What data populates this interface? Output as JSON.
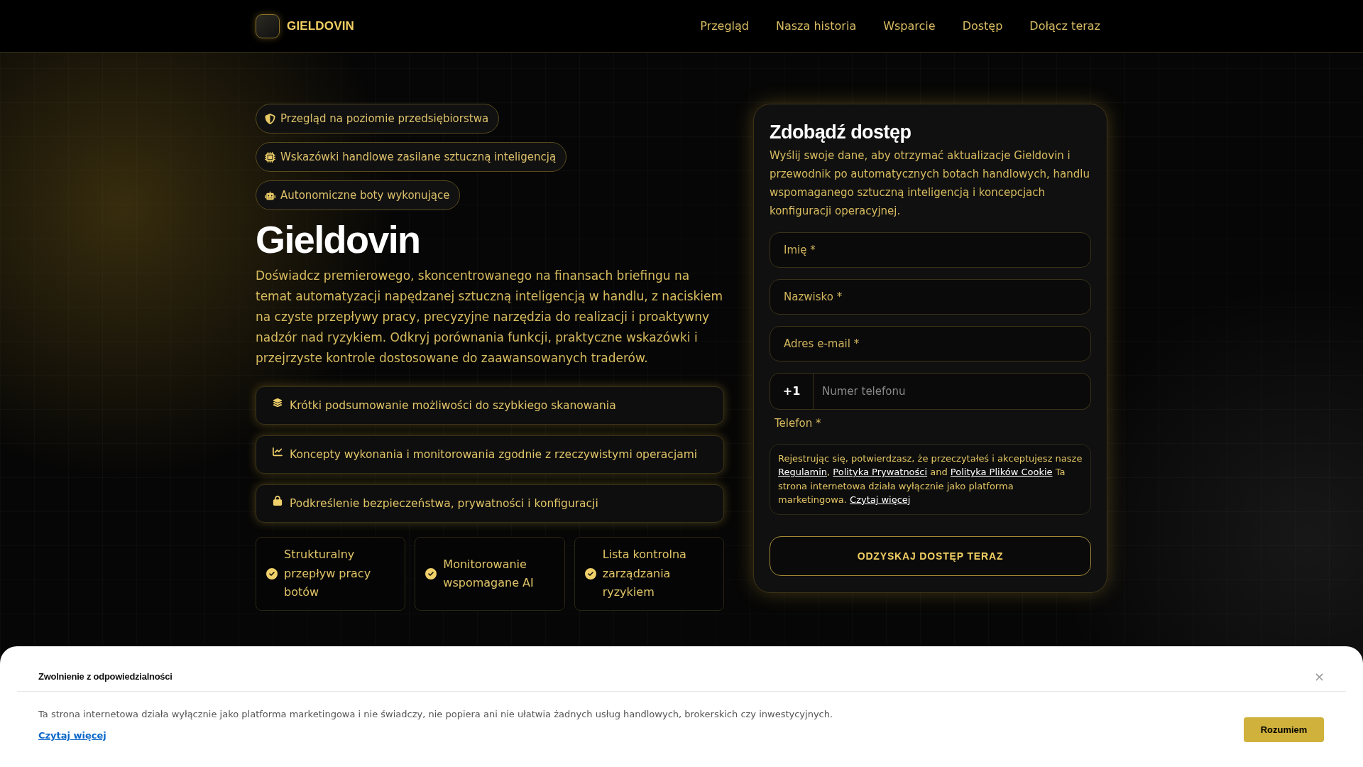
{
  "header": {
    "logo_text": "GIELDOVIN",
    "nav": [
      "Przegląd",
      "Nasza historia",
      "Wsparcie",
      "Dostęp",
      "Dołącz teraz"
    ]
  },
  "hero": {
    "badges": [
      "Przegląd na poziomie przedsiębiorstwa",
      "Wskazówki handlowe zasilane sztuczną inteligencją",
      "Autonomiczne boty wykonujące"
    ],
    "title": "Gieldovin",
    "description": "Doświadcz premierowego, skoncentrowanego na finansach briefingu na temat automatyzacji napędzanej sztuczną inteligencją w handlu, z naciskiem na czyste przepływy pracy, precyzyjne narzędzia do realizacji i proaktywny nadzór nad ryzykiem. Odkryj porównania funkcji, praktyczne wskazówki i przejrzyste kontrole dostosowane do zaawansowanych traderów.",
    "features": [
      "Krótki podsumowanie możliwości do szybkiego skanowania",
      "Koncepty wykonania i monitorowania zgodnie z rzeczywistymi operacjami",
      "Podkreślenie bezpieczeństwa, prywatności i konfiguracji"
    ],
    "highlights": [
      "Strukturalny przepływ pracy botów",
      "Monitorowanie wspomagane AI",
      "Lista kontrolna zarządzania ryzykiem"
    ]
  },
  "form": {
    "title": "Zdobądź dostęp",
    "description": "Wyślij swoje dane, aby otrzymać aktualizacje Gieldovin i przewodnik po automatycznych botach handlowych, handlu wspomaganego sztuczną inteligencją i koncepcjach konfiguracji operacyjnej.",
    "fields": [
      {
        "kind": "text",
        "placeholder": "Imię *"
      },
      {
        "kind": "text",
        "placeholder": "Nazwisko *"
      },
      {
        "kind": "text",
        "placeholder": "Adres e-mail *"
      },
      {
        "kind": "phone",
        "prefix": "+1",
        "placeholder": "Numer telefonu",
        "label": "Telefon *"
      }
    ],
    "consent": [
      {
        "kind": "text",
        "text": "Rejestrując się, potwierdzasz, że przeczytałeś i akceptujesz nasze "
      },
      {
        "kind": "link",
        "text": "Regulamin"
      },
      {
        "kind": "text",
        "text": ", "
      },
      {
        "kind": "link",
        "text": "Polityka Prywatności"
      },
      {
        "kind": "text",
        "text": " and "
      },
      {
        "kind": "link",
        "text": "Polityka Plików Cookie"
      },
      {
        "kind": "text",
        "text": " Ta strona internetowa działa wyłącznie jako platforma marketingowa. "
      },
      {
        "kind": "link",
        "text": "Czytaj więcej"
      }
    ],
    "submit": "ODZYSKAJ DOSTĘP TERAZ"
  },
  "disclaimer": {
    "title": "Zwolnienie z odpowiedzialności",
    "close": "×",
    "text": "Ta strona internetowa działa wyłącznie jako platforma marketingowa i nie świadczy, nie popiera ani nie ułatwia żadnych usług handlowych, brokerskich czy inwestycyjnych.",
    "link": "Czytaj więcej",
    "button": "Rozumiem"
  }
}
